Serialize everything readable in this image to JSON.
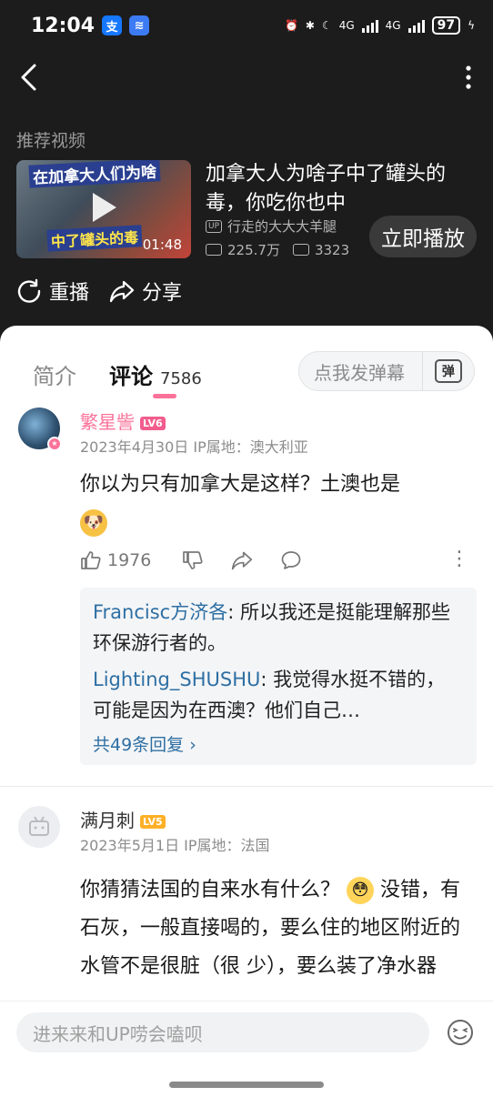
{
  "status_bar": {
    "time": "12:04",
    "network1": "4G",
    "network2": "4G",
    "battery": "97"
  },
  "recommend": {
    "section_title": "推荐视频",
    "thumb_caption_top": "在加拿大人们为啥",
    "thumb_caption_bottom": "中了罐头的毒",
    "duration": "01:48",
    "title": "加拿大人为啥子中了罐头的毒，你吃你也中",
    "up_badge": "UP",
    "uploader": "行走的大大大羊腿",
    "views": "225.7万",
    "danmaku": "3323",
    "play_now": "立即播放",
    "replay": "重播",
    "share": "分享"
  },
  "tabs": {
    "intro": "简介",
    "comments": "评论",
    "comment_count": "7586",
    "danmu_placeholder": "点我发弹幕",
    "danmu_icon_text": "弹"
  },
  "comments": [
    {
      "username": "繁星訾",
      "level": "LV6",
      "meta": "2023年4月30日 IP属地：澳大利亚",
      "text": "你以为只有加拿大是这样？土澳也是",
      "likes": "1976",
      "replies": [
        {
          "name": "Francisc方济各",
          "text": ": 所以我还是挺能理解那些环保游行者的。"
        },
        {
          "name": "Lighting_SHUSHU",
          "text": ": 我觉得水挺不错的，可能是因为在西澳？他们自己…"
        }
      ],
      "more_replies": "共49条回复"
    },
    {
      "username": "满月刺",
      "level": "LV5",
      "meta": "2023年5月1日 IP属地：法国",
      "text_a": "你猜猜法国的自来水有什么？",
      "text_b": "没错，有石灰，一般直接喝的，要么住的地区附近的水管不是很脏（很",
      "text_c": "少），要么装了净水器"
    }
  ],
  "bottom": {
    "input_placeholder": "进来来和UP唠会嗑呗"
  },
  "colors": {
    "accent_pink": "#fb7299",
    "link_blue": "#2e6fa3",
    "dark_bg": "#1c1c1c"
  }
}
